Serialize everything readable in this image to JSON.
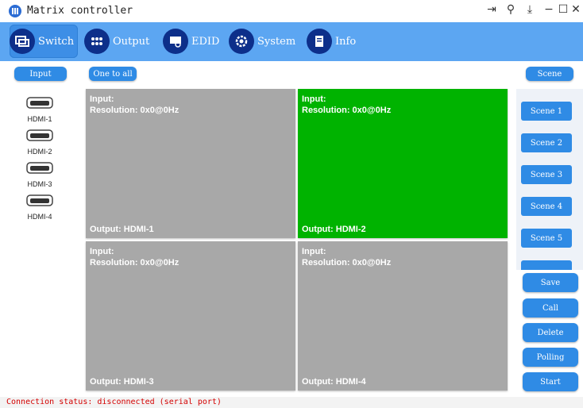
{
  "window": {
    "title": "Matrix controller"
  },
  "tabs": [
    {
      "label": "Switch",
      "icon": "window-switch-icon",
      "active": true
    },
    {
      "label": "Output",
      "icon": "output-dots-icon",
      "active": false
    },
    {
      "label": "EDID",
      "icon": "edid-monitor-icon",
      "active": false
    },
    {
      "label": "System",
      "icon": "gear-icon",
      "active": false
    },
    {
      "label": "Info",
      "icon": "document-icon",
      "active": false
    }
  ],
  "controls": {
    "input_label": "Input",
    "one_to_all_label": "One to all",
    "scene_label": "Scene"
  },
  "inputs": [
    {
      "label": "HDMI-1"
    },
    {
      "label": "HDMI-2"
    },
    {
      "label": "HDMI-3"
    },
    {
      "label": "HDMI-4"
    }
  ],
  "outputs": [
    {
      "input": "Input:",
      "resolution": "Resolution: 0x0@0Hz",
      "output": "Output: HDMI-1",
      "selected": false
    },
    {
      "input": "Input:",
      "resolution": "Resolution: 0x0@0Hz",
      "output": "Output: HDMI-2",
      "selected": true
    },
    {
      "input": "Input:",
      "resolution": "Resolution: 0x0@0Hz",
      "output": "Output: HDMI-3",
      "selected": false
    },
    {
      "input": "Input:",
      "resolution": "Resolution: 0x0@0Hz",
      "output": "Output: HDMI-4",
      "selected": false
    }
  ],
  "scenes": [
    "Scene 1",
    "Scene 2",
    "Scene 3",
    "Scene 4",
    "Scene 5"
  ],
  "actions": {
    "save": "Save",
    "call": "Call",
    "delete": "Delete",
    "polling": "Polling",
    "start": "Start"
  },
  "status": {
    "text": "Connection status: disconnected (serial port)"
  },
  "colors": {
    "toolbar": "#5ca6f2",
    "button": "#2f8be5",
    "selected_output": "#00b300",
    "idle_output": "#a8a8a8",
    "status_text": "#d40000"
  }
}
